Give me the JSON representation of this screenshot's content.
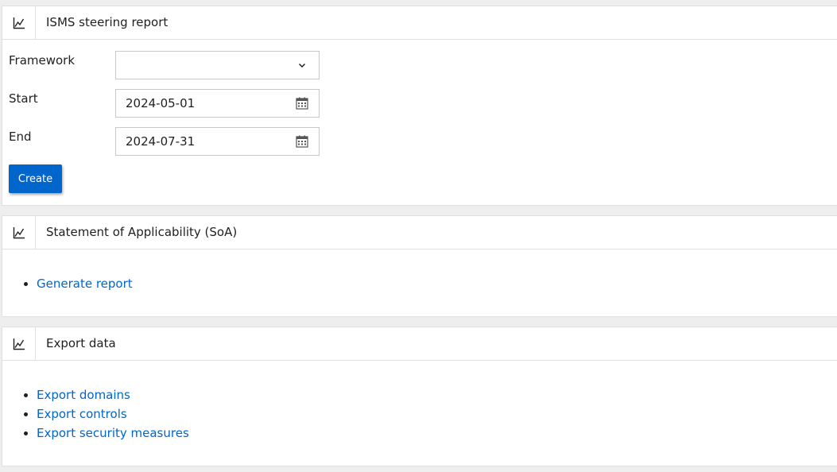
{
  "steering": {
    "title": "ISMS steering report",
    "icon": "line-chart-icon",
    "framework_label": "Framework",
    "framework_value": "",
    "start_label": "Start",
    "start_value": "2024-05-01",
    "end_label": "End",
    "end_value": "2024-07-31",
    "create_label": "Create"
  },
  "soa": {
    "title": "Statement of Applicability (SoA)",
    "icon": "line-chart-icon",
    "links": [
      {
        "label": "Generate report"
      }
    ]
  },
  "export": {
    "title": "Export data",
    "icon": "line-chart-icon",
    "links": [
      {
        "label": "Export domains"
      },
      {
        "label": "Export controls"
      },
      {
        "label": "Export security measures"
      }
    ]
  },
  "colors": {
    "link": "#0066cc",
    "button": "#0066cc",
    "background": "#eeeeee",
    "border": "#e0e0e0"
  }
}
